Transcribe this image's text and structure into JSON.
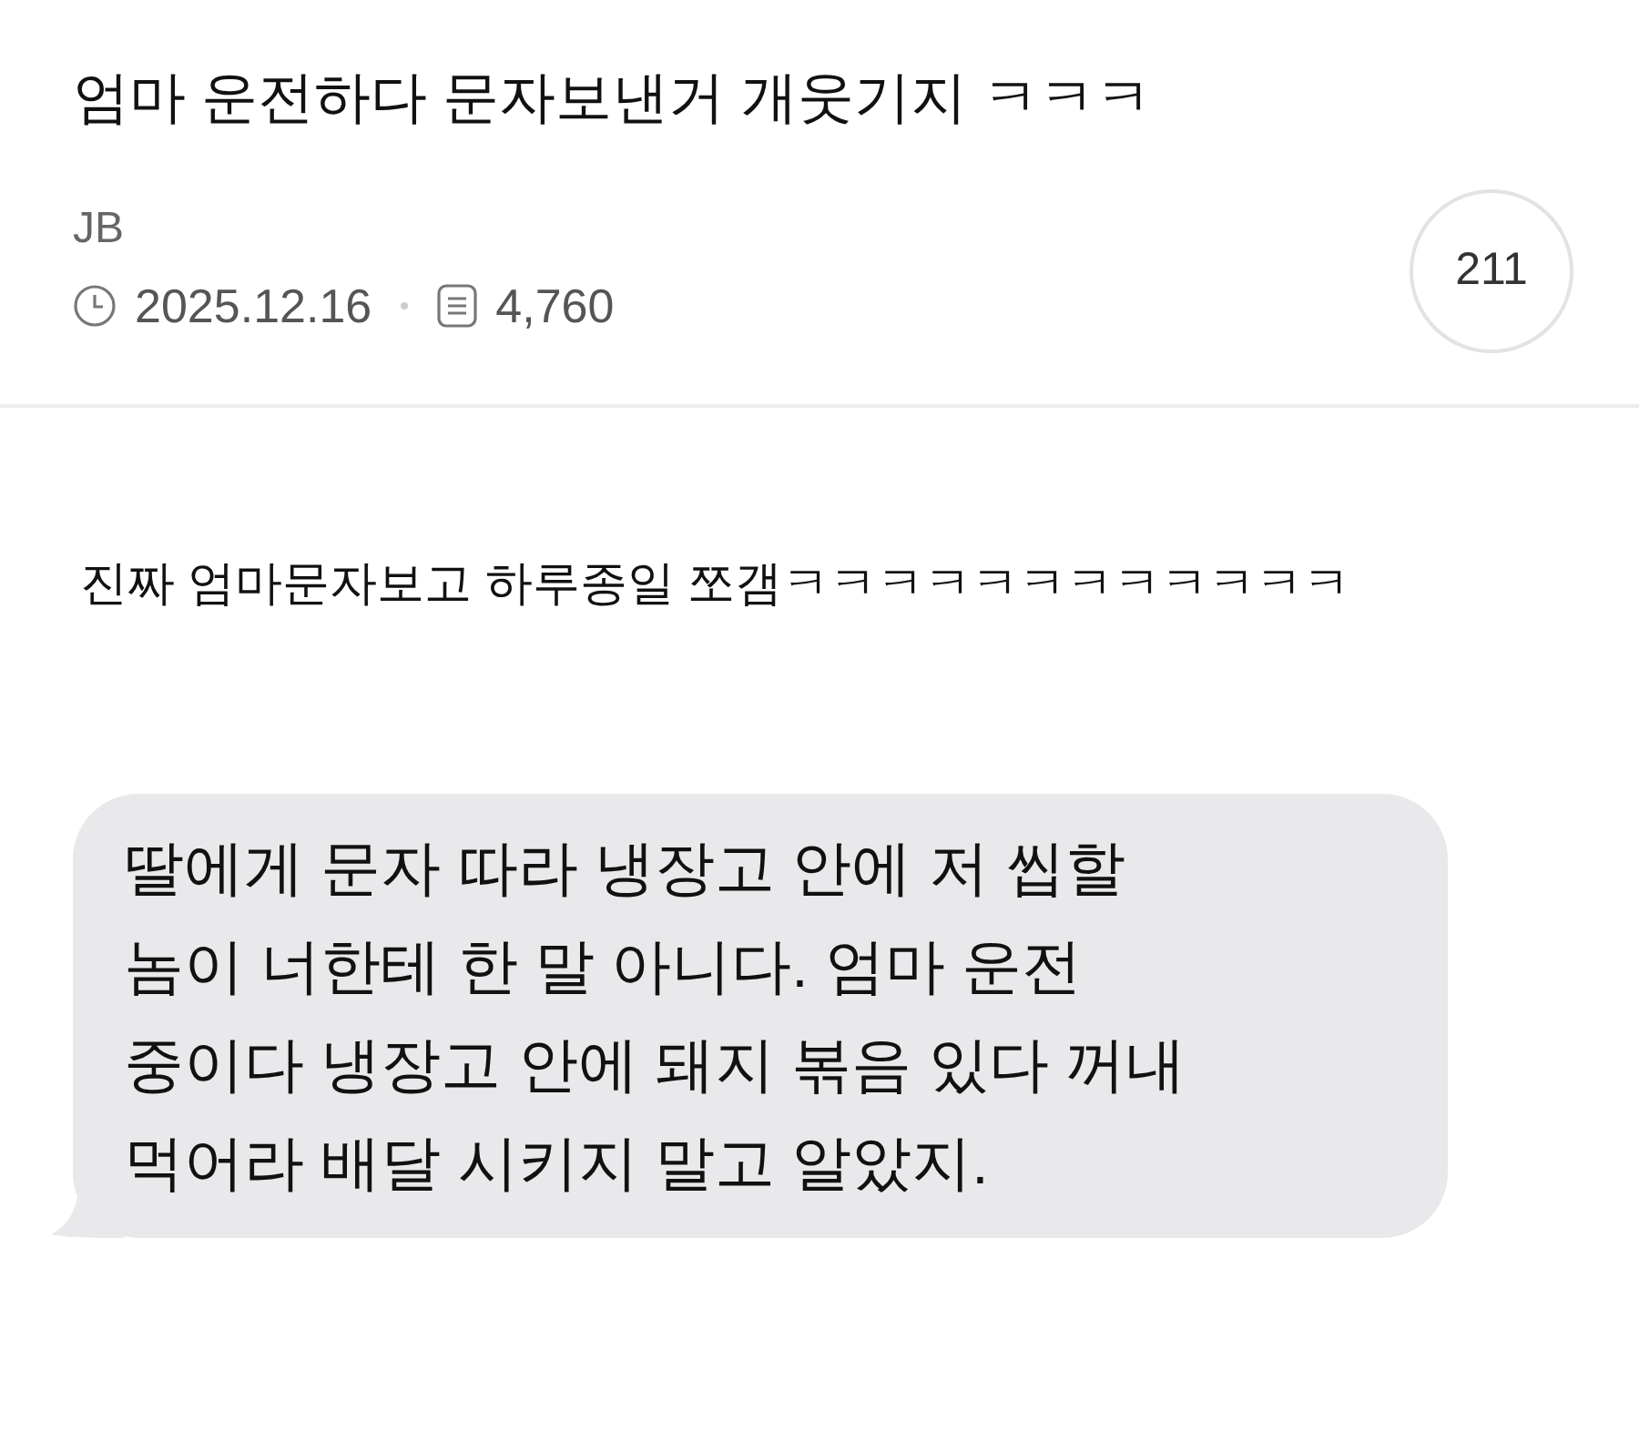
{
  "post": {
    "title": "엄마 운전하다 문자보낸거 개웃기지 ㅋㅋㅋ",
    "author": "JB",
    "date": "2025.12.16",
    "views": "4,760",
    "comment_count": "211"
  },
  "body": {
    "text": "진짜 엄마문자보고 하루종일 쪼갬ㅋㅋㅋㅋㅋㅋㅋㅋㅋㅋㅋㅋ",
    "message_lines": [
      "딸에게 문자 따라 냉장고 안에 저 씹할",
      "놈이 너한테 한 말 아니다. 엄마 운전",
      "중이다 냉장고 안에 돼지 볶음 있다 꺼내",
      "먹어라 배달 시키지 말고 알았지."
    ]
  }
}
